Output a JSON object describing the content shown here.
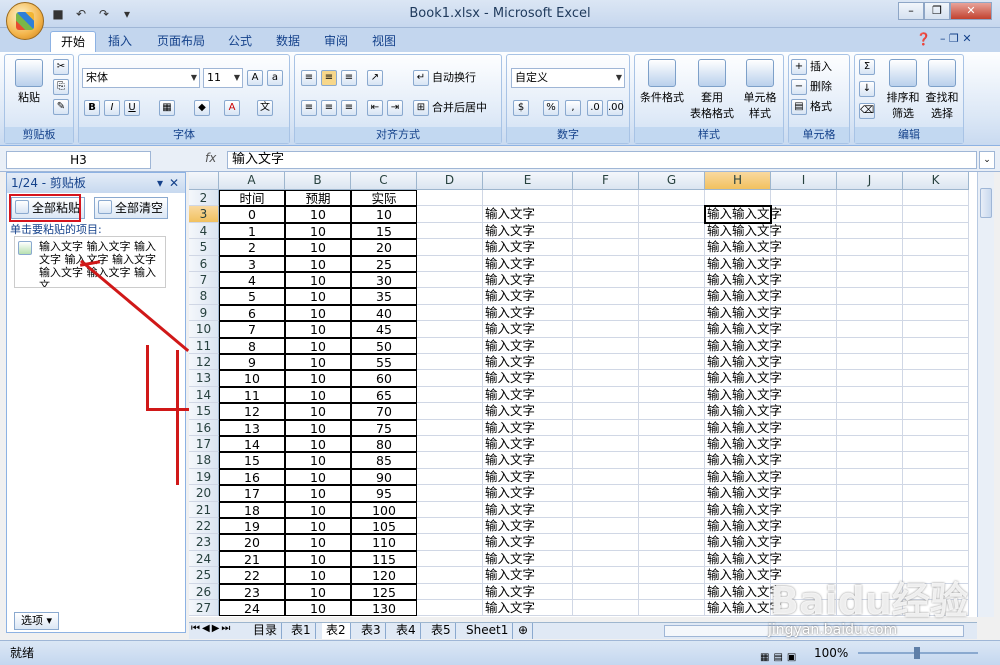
{
  "window": {
    "title": "Book1.xlsx - Microsoft Excel"
  },
  "tabs": [
    "开始",
    "插入",
    "页面布局",
    "公式",
    "数据",
    "审阅",
    "视图"
  ],
  "ribbon": {
    "clipboard": {
      "label": "剪贴板",
      "paste": "粘贴"
    },
    "font": {
      "label": "字体",
      "name": "宋体",
      "size": "11"
    },
    "align": {
      "label": "对齐方式",
      "wrap": "自动换行",
      "merge": "合并后居中"
    },
    "number": {
      "label": "数字",
      "format": "自定义",
      "percent": "%",
      "comma": ","
    },
    "styles": {
      "label": "样式",
      "cond": "条件格式",
      "table_a": "套用",
      "table_b": "表格格式",
      "cell_a": "单元格",
      "cell_b": "样式"
    },
    "cells": {
      "label": "单元格",
      "insert": "插入",
      "delete": "删除",
      "format": "格式"
    },
    "editing": {
      "label": "编辑",
      "sort_a": "排序和",
      "sort_b": "筛选",
      "find_a": "查找和",
      "find_b": "选择"
    }
  },
  "formula_bar": {
    "name_box": "H3",
    "fx": "fx",
    "content": "输入文字"
  },
  "clipboard_pane": {
    "title": "1/24 - 剪贴板",
    "paste_all": "全部粘贴",
    "clear_all": "全部清空",
    "hint": "单击要粘贴的项目:",
    "item": "输入文字 输入文字 输入文字 输入文字 输入文字 输入文字 输入文字 输入文...",
    "options": "选项"
  },
  "columns": [
    "A",
    "B",
    "C",
    "D",
    "E",
    "F",
    "G",
    "H",
    "I",
    "J",
    "K"
  ],
  "header_row": {
    "row": "2",
    "a": "时间",
    "b": "预期",
    "c": "实际"
  },
  "rows": [
    {
      "r": "3",
      "a": "0",
      "b": "10",
      "c": "10"
    },
    {
      "r": "4",
      "a": "1",
      "b": "10",
      "c": "15"
    },
    {
      "r": "5",
      "a": "2",
      "b": "10",
      "c": "20"
    },
    {
      "r": "6",
      "a": "3",
      "b": "10",
      "c": "25"
    },
    {
      "r": "7",
      "a": "4",
      "b": "10",
      "c": "30"
    },
    {
      "r": "8",
      "a": "5",
      "b": "10",
      "c": "35"
    },
    {
      "r": "9",
      "a": "6",
      "b": "10",
      "c": "40"
    },
    {
      "r": "10",
      "a": "7",
      "b": "10",
      "c": "45"
    },
    {
      "r": "11",
      "a": "8",
      "b": "10",
      "c": "50"
    },
    {
      "r": "12",
      "a": "9",
      "b": "10",
      "c": "55"
    },
    {
      "r": "13",
      "a": "10",
      "b": "10",
      "c": "60"
    },
    {
      "r": "14",
      "a": "11",
      "b": "10",
      "c": "65"
    },
    {
      "r": "15",
      "a": "12",
      "b": "10",
      "c": "70"
    },
    {
      "r": "16",
      "a": "13",
      "b": "10",
      "c": "75"
    },
    {
      "r": "17",
      "a": "14",
      "b": "10",
      "c": "80"
    },
    {
      "r": "18",
      "a": "15",
      "b": "10",
      "c": "85"
    },
    {
      "r": "19",
      "a": "16",
      "b": "10",
      "c": "90"
    },
    {
      "r": "20",
      "a": "17",
      "b": "10",
      "c": "95"
    },
    {
      "r": "21",
      "a": "18",
      "b": "10",
      "c": "100"
    },
    {
      "r": "22",
      "a": "19",
      "b": "10",
      "c": "105"
    },
    {
      "r": "23",
      "a": "20",
      "b": "10",
      "c": "110"
    },
    {
      "r": "24",
      "a": "21",
      "b": "10",
      "c": "115"
    },
    {
      "r": "25",
      "a": "22",
      "b": "10",
      "c": "120"
    },
    {
      "r": "26",
      "a": "23",
      "b": "10",
      "c": "125"
    },
    {
      "r": "27",
      "a": "24",
      "b": "10",
      "c": "130"
    }
  ],
  "col_e_text": "输入文字",
  "col_h_text": "输入输入文字",
  "sheets": [
    "目录",
    "表1",
    "表2",
    "表3",
    "表4",
    "表5",
    "Sheet1"
  ],
  "active_sheet": "表2",
  "status": {
    "left": "就绪",
    "zoom": "100%"
  },
  "watermark": {
    "logo": "Baidu经验",
    "url": "jingyan.baidu.com"
  }
}
